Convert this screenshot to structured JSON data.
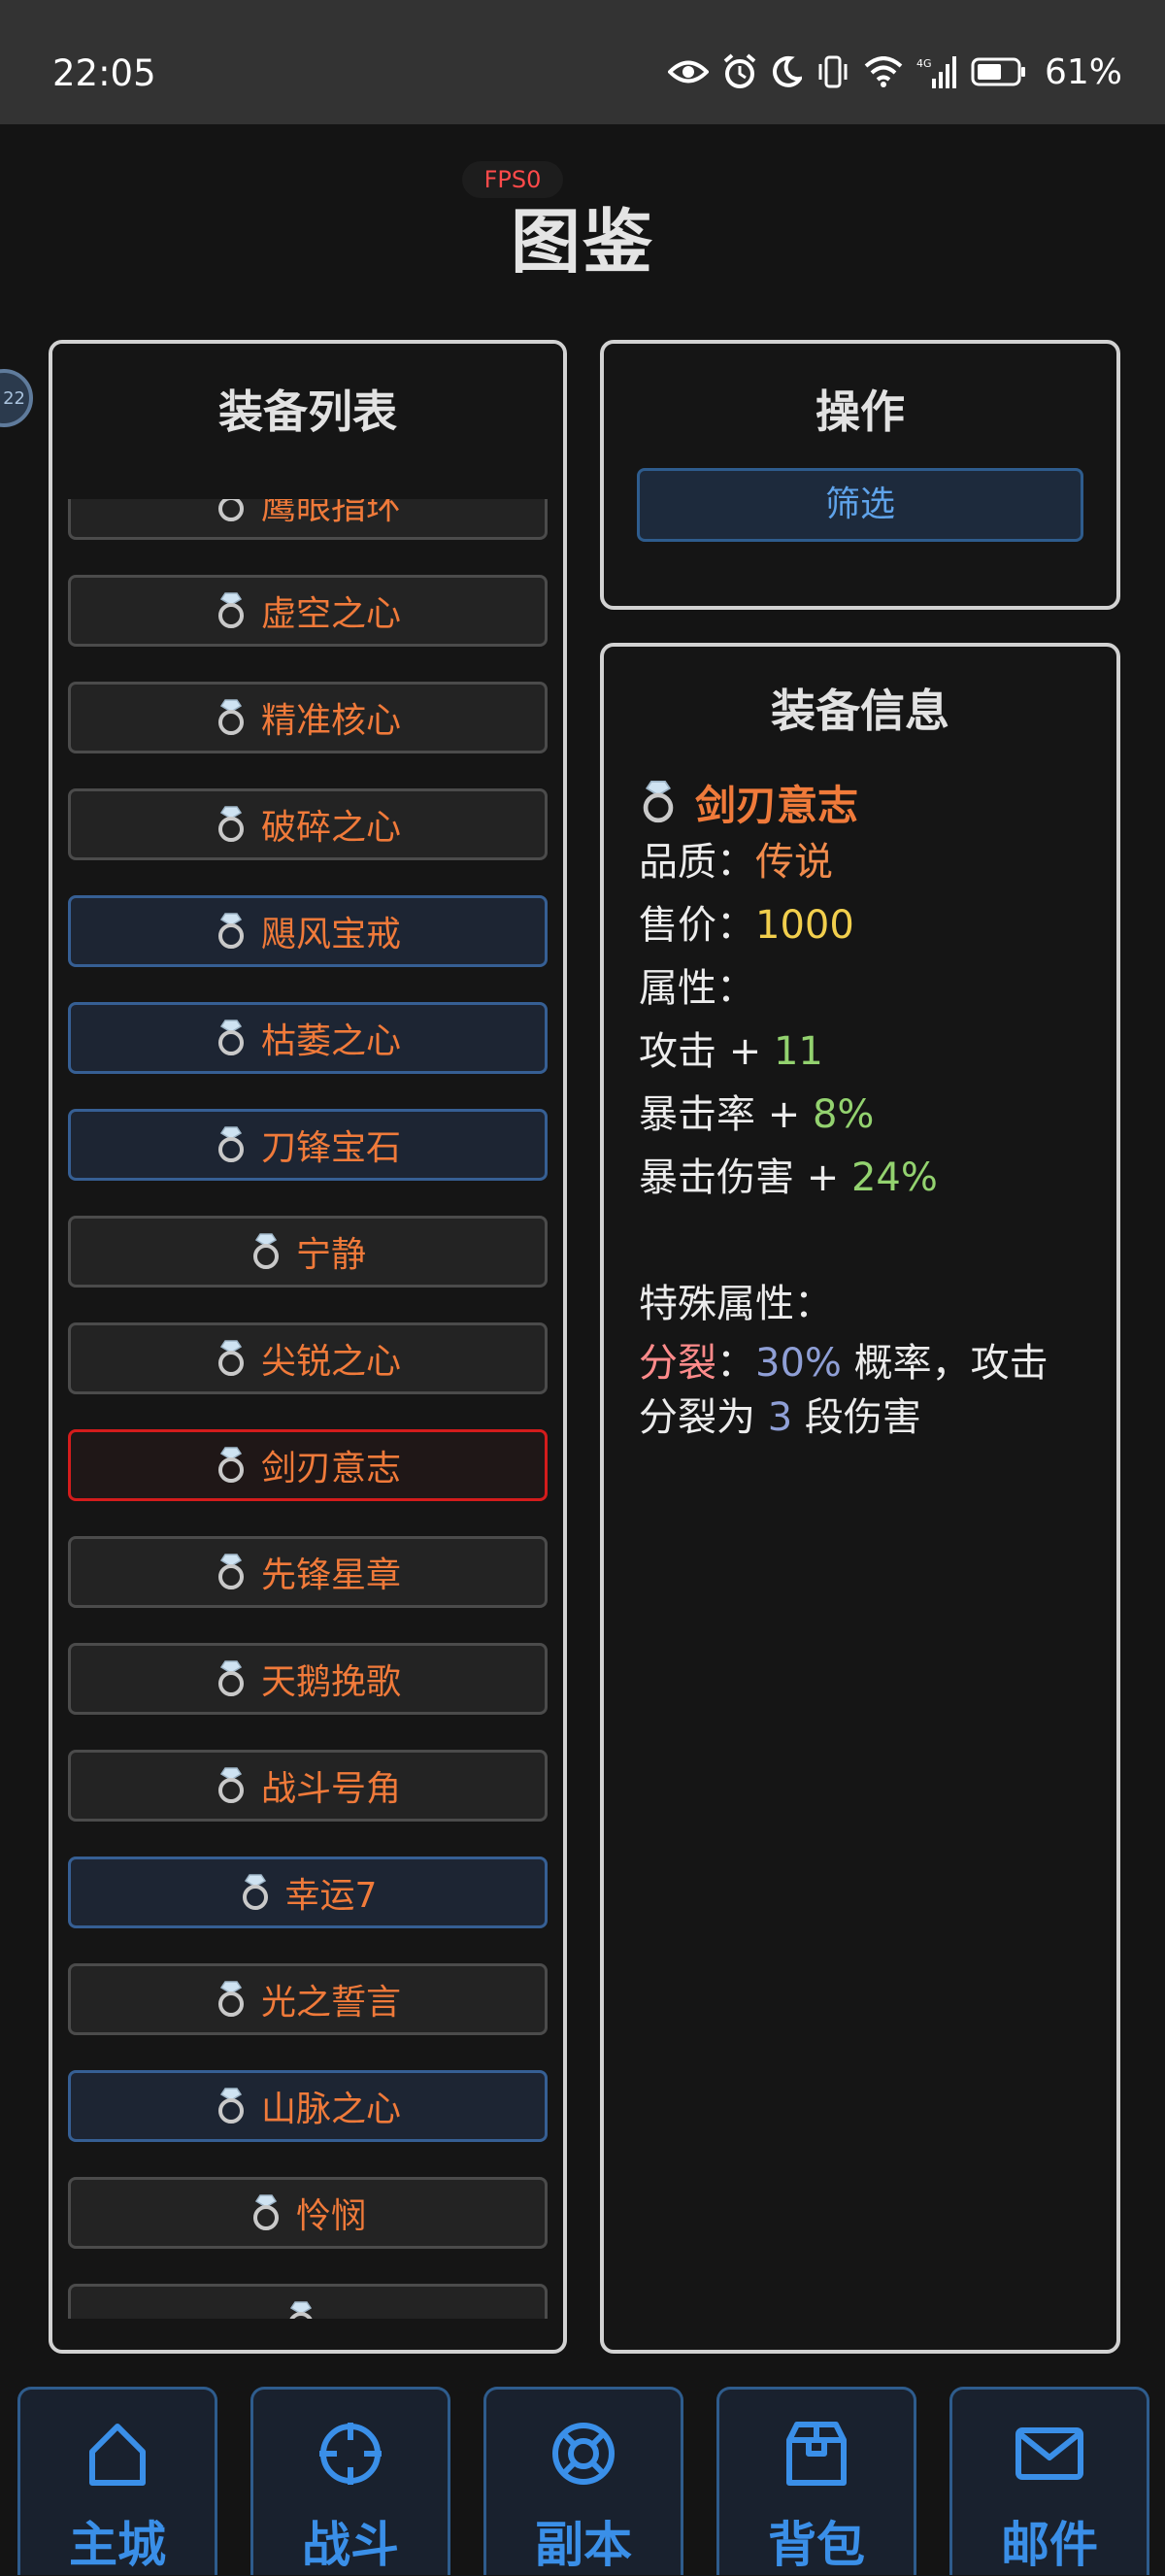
{
  "status_bar": {
    "time": "22:05",
    "battery": "61%"
  },
  "fps": "FPS0",
  "title": "图鉴",
  "side_badge": "22",
  "list_panel": {
    "title": "装备列表",
    "items": [
      {
        "name": "鹰眼指环",
        "rarity": "normal"
      },
      {
        "name": "虚空之心",
        "rarity": "normal"
      },
      {
        "name": "精准核心",
        "rarity": "normal"
      },
      {
        "name": "破碎之心",
        "rarity": "normal"
      },
      {
        "name": "飓风宝戒",
        "rarity": "rare"
      },
      {
        "name": "枯萎之心",
        "rarity": "rare"
      },
      {
        "name": "刀锋宝石",
        "rarity": "rare"
      },
      {
        "name": "宁静",
        "rarity": "normal"
      },
      {
        "name": "尖锐之心",
        "rarity": "normal"
      },
      {
        "name": "剑刃意志",
        "rarity": "selected"
      },
      {
        "name": "先锋星章",
        "rarity": "normal"
      },
      {
        "name": "天鹅挽歌",
        "rarity": "normal"
      },
      {
        "name": "战斗号角",
        "rarity": "normal"
      },
      {
        "name": "幸运7",
        "rarity": "rare"
      },
      {
        "name": "光之誓言",
        "rarity": "normal"
      },
      {
        "name": "山脉之心",
        "rarity": "rare"
      },
      {
        "name": "怜悯",
        "rarity": "normal"
      },
      {
        "name": "",
        "rarity": "normal"
      }
    ]
  },
  "ops_panel": {
    "title": "操作",
    "filter_label": "筛选"
  },
  "info_panel": {
    "title": "装备信息",
    "name": "剑刃意志",
    "quality_label": "品质：",
    "quality_value": "传说",
    "price_label": "售价：",
    "price_value": "1000",
    "attrs_label": "属性：",
    "attack_label": "攻击 + ",
    "attack_value": "11",
    "crit_label": "暴击率 + ",
    "crit_value": "8%",
    "critdmg_label": "暴击伤害 + ",
    "critdmg_value": "24%",
    "special_label": "特殊属性：",
    "special_name": "分裂",
    "special_sep": "：",
    "special_chance": "30%",
    "special_mid": " 概率，攻击分裂为 ",
    "special_count": "3",
    "special_end": " 段伤害"
  },
  "nav": [
    {
      "label": "主城",
      "icon": "home-icon"
    },
    {
      "label": "战斗",
      "icon": "crosshair-icon"
    },
    {
      "label": "副本",
      "icon": "lifebuoy-icon"
    },
    {
      "label": "背包",
      "icon": "package-icon"
    },
    {
      "label": "邮件",
      "icon": "mail-icon"
    }
  ],
  "colors": {
    "legendary": "#f08b4c",
    "gold": "#f2cf4d",
    "green": "#93d26f",
    "purple": "#8f9fd6",
    "accent_blue": "#3a8fe8",
    "selected_border": "#d41c1c"
  }
}
